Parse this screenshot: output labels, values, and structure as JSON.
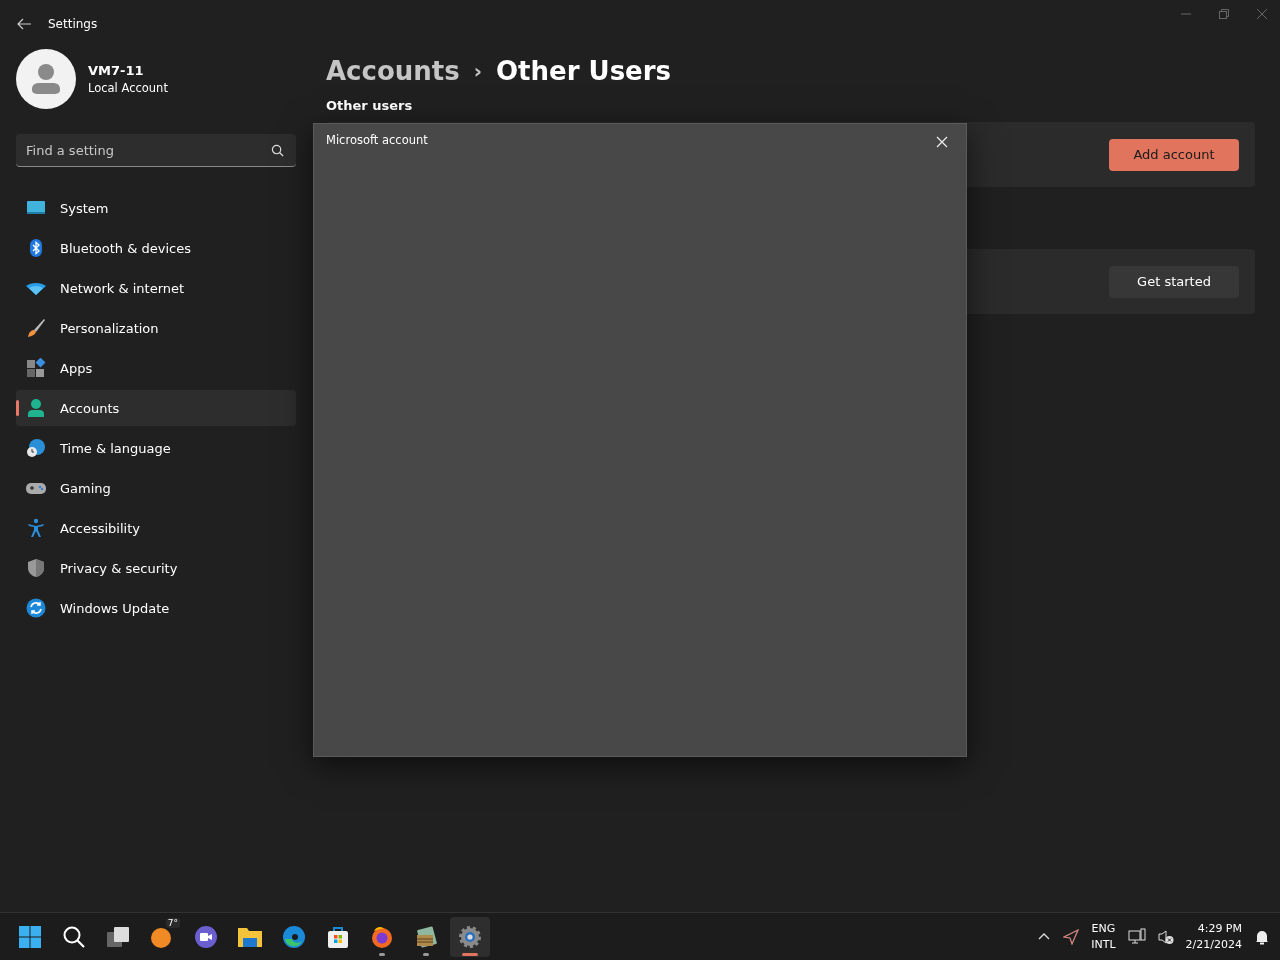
{
  "window": {
    "title": "Settings"
  },
  "user": {
    "name": "VM7-11",
    "account_type": "Local Account"
  },
  "search": {
    "placeholder": "Find a setting"
  },
  "sidebar": {
    "items": [
      {
        "label": "System",
        "kind": "system",
        "selected": false
      },
      {
        "label": "Bluetooth & devices",
        "kind": "bluetooth",
        "selected": false
      },
      {
        "label": "Network & internet",
        "kind": "network",
        "selected": false
      },
      {
        "label": "Personalization",
        "kind": "brush",
        "selected": false
      },
      {
        "label": "Apps",
        "kind": "apps",
        "selected": false
      },
      {
        "label": "Accounts",
        "kind": "accounts",
        "selected": true
      },
      {
        "label": "Time & language",
        "kind": "time",
        "selected": false
      },
      {
        "label": "Gaming",
        "kind": "gaming",
        "selected": false
      },
      {
        "label": "Accessibility",
        "kind": "accessibility",
        "selected": false
      },
      {
        "label": "Privacy & security",
        "kind": "privacy",
        "selected": false
      },
      {
        "label": "Windows Update",
        "kind": "update",
        "selected": false
      }
    ]
  },
  "breadcrumb": {
    "parent": "Accounts",
    "separator": "›",
    "current": "Other Users"
  },
  "section_title": "Other users",
  "cards": [
    {
      "button": "Add account",
      "primary": true
    },
    {
      "button": "Get started",
      "primary": false
    }
  ],
  "dialog": {
    "title": "Microsoft account"
  },
  "taskbar": {
    "apps": [
      {
        "kind": "start",
        "running": false,
        "active": false
      },
      {
        "kind": "search",
        "running": false,
        "active": false
      },
      {
        "kind": "taskview",
        "running": false,
        "active": false
      },
      {
        "kind": "weather",
        "badge": "7°",
        "running": false,
        "active": false
      },
      {
        "kind": "chat",
        "running": false,
        "active": false
      },
      {
        "kind": "folder",
        "running": false,
        "active": false
      },
      {
        "kind": "edge",
        "running": false,
        "active": false
      },
      {
        "kind": "store",
        "running": false,
        "active": false
      },
      {
        "kind": "firefox",
        "running": true,
        "active": false
      },
      {
        "kind": "archive",
        "running": true,
        "active": false
      },
      {
        "kind": "settings",
        "running": true,
        "active": true
      }
    ],
    "language": [
      "ENG",
      "INTL"
    ],
    "time": "4:29 PM",
    "date": "2/21/2024"
  }
}
